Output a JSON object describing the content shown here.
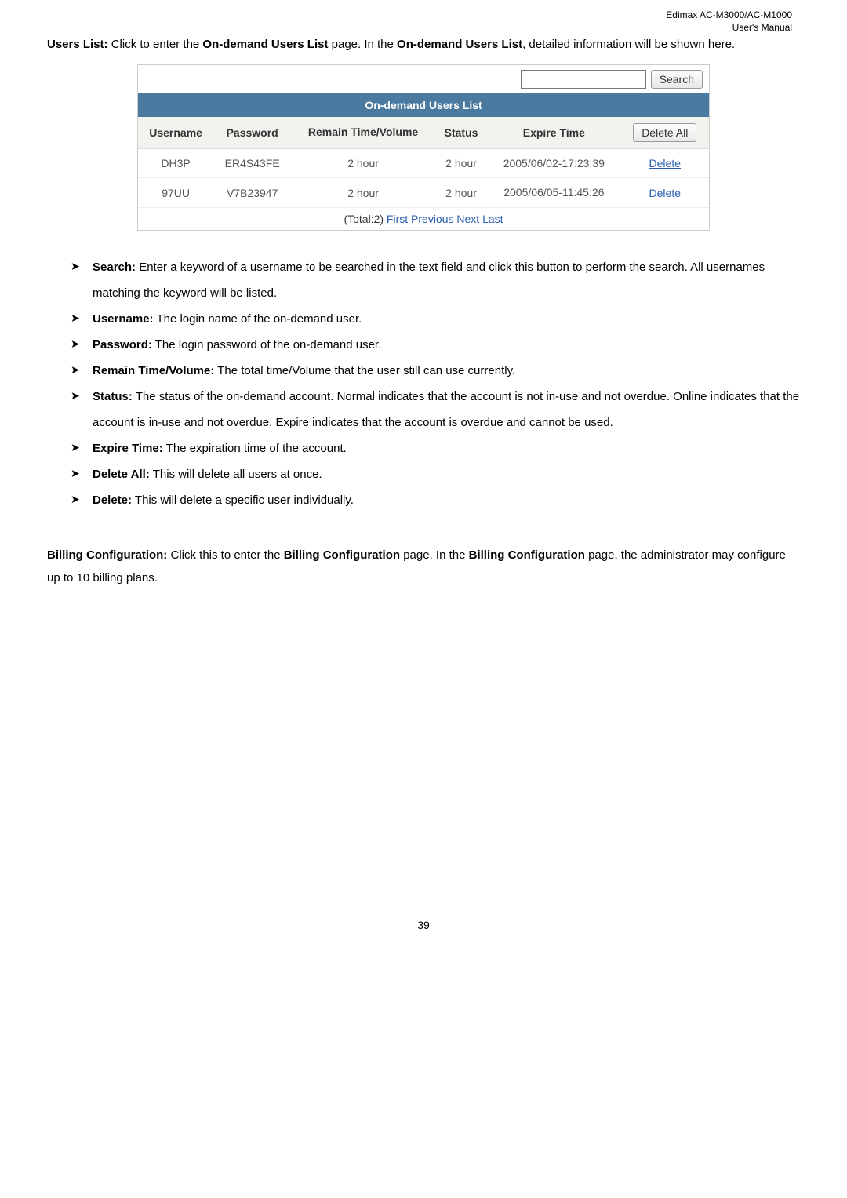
{
  "header": {
    "product": "Edimax  AC-M3000/AC-M1000",
    "doc": "User's  Manual"
  },
  "intro": {
    "bold1": "Users List:",
    "t1": " Click to enter the ",
    "bold2": "On-demand Users List",
    "t2": " page. In the ",
    "bold3": "On-demand Users List",
    "t3": ", detailed information will be shown here."
  },
  "search_button": "Search",
  "table_title": "On-demand Users List",
  "columns": {
    "username": "Username",
    "password": "Password",
    "remain": "Remain Time/Volume",
    "status": "Status",
    "expire": "Expire Time",
    "delete_all": "Delete All"
  },
  "rows": [
    {
      "username": "DH3P",
      "password": "ER4S43FE",
      "remain": "2 hour",
      "status": "2 hour",
      "expire": "2005/06/02-17:23:39",
      "action": "Delete"
    },
    {
      "username": "97UU",
      "password": "V7B23947",
      "remain": "2 hour",
      "status": "2 hour",
      "expire": "2005/06/05-11:45:26",
      "action": "Delete"
    }
  ],
  "pager": {
    "total": "(Total:2) ",
    "first": "First",
    "prev": "Previous",
    "next": "Next",
    "last": "Last"
  },
  "bullets": {
    "search": {
      "head": "Search:",
      "body": " Enter a keyword of a username to be searched in the text field and click this button to perform the search. All usernames matching the keyword will be listed."
    },
    "username": {
      "head": "Username:",
      "body": " The login name of the on-demand user."
    },
    "password": {
      "head": "Password:",
      "body": " The login password of the on-demand user."
    },
    "remain": {
      "head": "Remain Time/Volume:",
      "body": " The total time/Volume that the user still can use currently."
    },
    "status": {
      "head": "Status:",
      "body": " The status of the on-demand account. Normal indicates that the account is not in-use and not overdue. Online indicates that the account is in-use and not overdue. Expire indicates that the account is overdue and cannot be used."
    },
    "expire": {
      "head": "Expire Time:",
      "body": " The expiration time of the account."
    },
    "delete_all": {
      "head": "Delete All:",
      "body": " This will delete all users at once."
    },
    "delete": {
      "head": "Delete:",
      "body": " This will delete a specific user individually."
    }
  },
  "billing": {
    "bold1": "Billing Configuration:",
    "t1": " Click this to enter the ",
    "bold2": "Billing Configuration",
    "t2": " page. In the ",
    "bold3": "Billing Configuration",
    "t3": " page, the administrator may configure up to 10 billing plans."
  },
  "page_number": "39"
}
